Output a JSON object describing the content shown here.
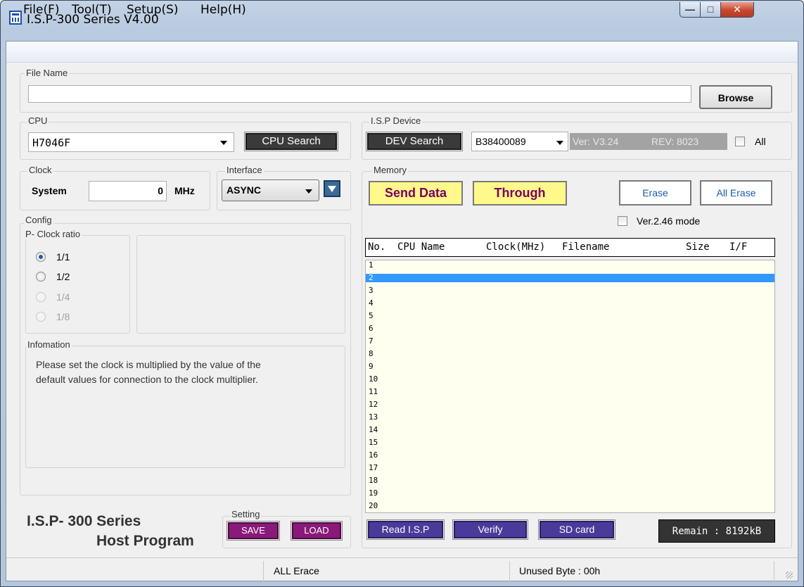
{
  "window": {
    "title": "I.S.P-300 Series V4.00"
  },
  "menu": [
    {
      "label": "File(F)"
    },
    {
      "label": "Tool(T)"
    },
    {
      "label": "Setup(S)"
    },
    {
      "label": "Help(H)"
    }
  ],
  "file_name": {
    "group_label": "File Name",
    "value": "",
    "browse_label": "Browse"
  },
  "cpu": {
    "group_label": "CPU",
    "selected": "H7046F",
    "search_label": "CPU Search"
  },
  "isp_device": {
    "group_label": "I.S.P Device",
    "search_label": "DEV Search",
    "selected": "B38400089",
    "version": "Ver: V3.24",
    "revision": "REV: 8023",
    "all_label": "All",
    "all_checked": false
  },
  "clock": {
    "group_label": "Clock",
    "system_label": "System",
    "value": "0",
    "unit": "MHz"
  },
  "interface": {
    "group_label": "Interface",
    "selected": "ASYNC"
  },
  "config": {
    "group_label": "Config",
    "ratio_label": "P- Clock ratio",
    "options": [
      {
        "label": "1/1",
        "checked": true,
        "enabled": true
      },
      {
        "label": "1/2",
        "checked": false,
        "enabled": true
      },
      {
        "label": "1/4",
        "checked": false,
        "enabled": false
      },
      {
        "label": "1/8",
        "checked": false,
        "enabled": false
      }
    ]
  },
  "information": {
    "group_label": "Infomation",
    "line1": "Please set the clock is multiplied by the value of the",
    "line2": "default values for connection to the clock multiplier."
  },
  "memory": {
    "group_label": "Memory",
    "send_data_label": "Send Data",
    "through_label": "Through",
    "erase_label": "Erase",
    "all_erase_label": "All Erase",
    "ver_mode_label": "Ver.2.46 mode",
    "ver_mode_checked": false,
    "columns": {
      "no": "No.",
      "cpu_name": "CPU Name",
      "clock": "Clock(MHz)",
      "filename": "Filename",
      "size": "Size",
      "if": "I/F"
    },
    "rows": [
      "1",
      "2",
      "3",
      "4",
      "5",
      "6",
      "7",
      "8",
      "9",
      "10",
      "11",
      "12",
      "13",
      "14",
      "15",
      "16",
      "17",
      "18",
      "19",
      "20"
    ],
    "selected_row": "2",
    "read_label": "Read I.S.P",
    "verify_label": "Verify",
    "sd_label": "SD card",
    "remain": "Remain : 8192kB"
  },
  "brand": {
    "line1": "I.S.P- 300  Series",
    "line2": "Host Program"
  },
  "setting": {
    "group_label": "Setting",
    "save_label": "SAVE",
    "load_label": "LOAD"
  },
  "status": {
    "left": "ALL Erace",
    "right": "Unused Byte : 00h"
  }
}
